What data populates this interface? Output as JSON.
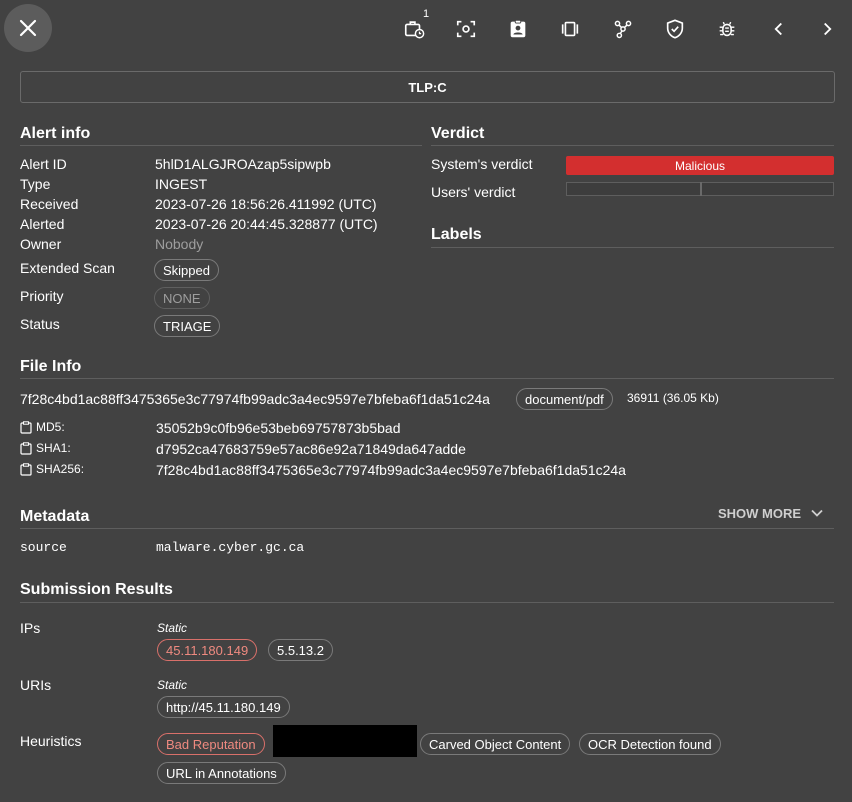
{
  "toolbar": {
    "ingest_count": "1",
    "icons": [
      "close-icon",
      "briefcase-clock-icon",
      "screenshot-icon",
      "clipboard-account-icon",
      "carousel-icon",
      "graph-icon",
      "shield-check-icon",
      "bug-icon",
      "chevron-left-icon",
      "chevron-right-icon"
    ]
  },
  "tlp": "TLP:C",
  "alert_info": {
    "title": "Alert info",
    "alert_id_label": "Alert ID",
    "alert_id": "5hlD1ALGJROAzap5sipwpb",
    "type_label": "Type",
    "type": "INGEST",
    "received_label": "Received",
    "received": "2023-07-26 18:56:26.411992 (UTC)",
    "alerted_label": "Alerted",
    "alerted": "2023-07-26 20:44:45.328877 (UTC)",
    "owner_label": "Owner",
    "owner": "Nobody",
    "extended_scan_label": "Extended Scan",
    "extended_scan": "Skipped",
    "priority_label": "Priority",
    "priority": "NONE",
    "status_label": "Status",
    "status": "TRIAGE"
  },
  "verdict": {
    "title": "Verdict",
    "system_label": "System's verdict",
    "system_value": "Malicious",
    "users_label": "Users' verdict"
  },
  "labels": {
    "title": "Labels"
  },
  "file_info": {
    "title": "File Info",
    "sha256_main": "7f28c4bd1ac88ff3475365e3c77974fb99adc3a4ec9597e7bfeba6f1da51c24a",
    "file_type": "document/pdf",
    "size": "36911 (36.05 Kb)",
    "md5_label": "MD5:",
    "md5": "35052b9c0fb96e53beb69757873b5bad",
    "sha1_label": "SHA1:",
    "sha1": "d7952ca47683759e57ac86e92a71849da647adde",
    "sha256_label": "SHA256:",
    "sha256": "7f28c4bd1ac88ff3475365e3c77974fb99adc3a4ec9597e7bfeba6f1da51c24a"
  },
  "metadata": {
    "title": "Metadata",
    "show_more": "SHOW MORE",
    "source_label": "source",
    "source_value": "malware.cyber.gc.ca"
  },
  "submission": {
    "title": "Submission Results",
    "ips_label": "IPs",
    "ips_group": "Static",
    "ip1": "45.11.180.149",
    "ip2": "5.5.13.2",
    "uris_label": "URIs",
    "uris_group": "Static",
    "uri1": "http://45.11.180.149",
    "heuristics_label": "Heuristics",
    "h1": "Bad Reputation",
    "h2": "Carved Object Content",
    "h3": "OCR Detection found",
    "h4": "URL in Annotations"
  }
}
